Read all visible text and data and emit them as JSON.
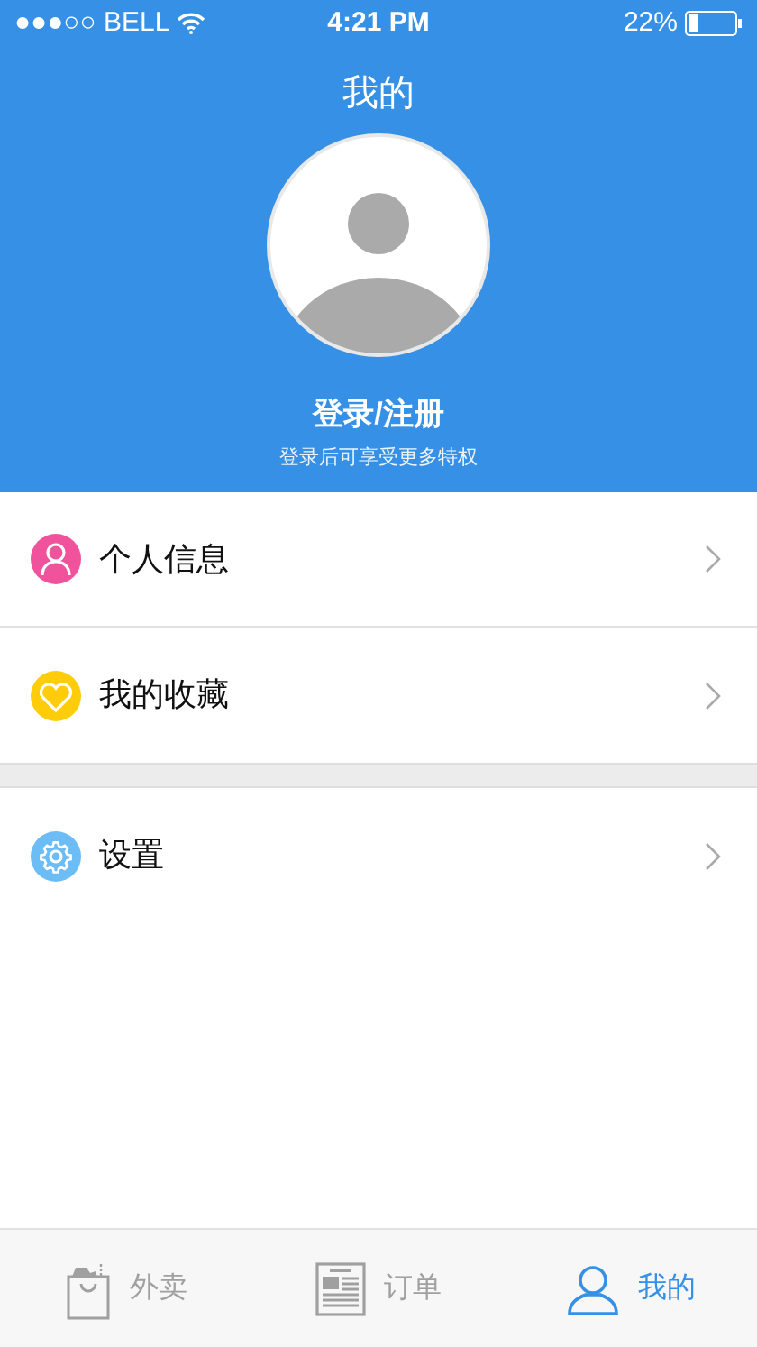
{
  "status_bar": {
    "carrier": "●●●○○ BELL",
    "time": "4:21 PM",
    "battery": "22%"
  },
  "header": {
    "title": "我的",
    "login": "登录/注册",
    "subtitle": "登录后可享受更多特权"
  },
  "menu_groups": [
    {
      "items": [
        {
          "label": "个人信息",
          "kind": "person",
          "color": "#f0529c"
        },
        {
          "label": "我的收藏",
          "kind": "heart",
          "color": "#ffcc0a"
        }
      ]
    },
    {
      "items": [
        {
          "label": "设置",
          "kind": "gear",
          "color": "#6cbcf5"
        }
      ]
    }
  ],
  "tab_bar": [
    {
      "label": "外卖",
      "kind": "bag",
      "selected": false
    },
    {
      "label": "订单",
      "kind": "news",
      "selected": false
    },
    {
      "label": "我的",
      "kind": "person",
      "selected": true
    }
  ]
}
